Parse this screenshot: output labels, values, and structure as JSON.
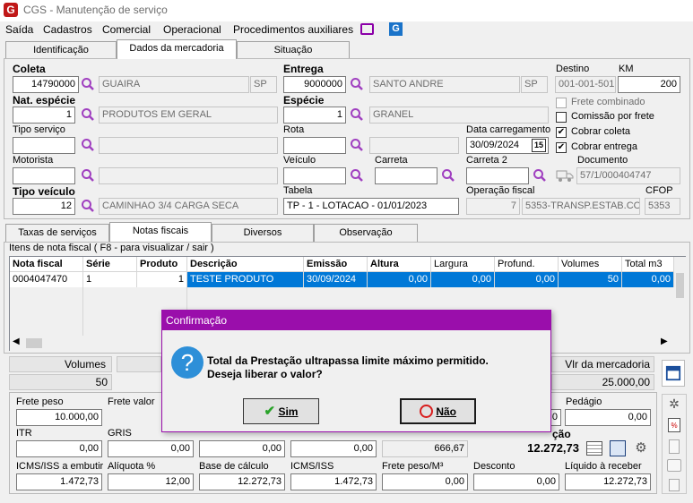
{
  "window": {
    "title": "CGS - Manutenção de serviço"
  },
  "menu": [
    "Saída",
    "Cadastros",
    "Comercial",
    "Operacional",
    "Procedimentos auxiliares"
  ],
  "top_tabs": [
    "Identificação",
    "Dados da mercadoria",
    "Situação"
  ],
  "header": {
    "coleta_label": "Coleta",
    "coleta_value": "14790000",
    "coleta_city": "GUAIRA",
    "coleta_uf": "SP",
    "entrega_label": "Entrega",
    "entrega_value": "9000000",
    "entrega_city": "SANTO ANDRE",
    "entrega_uf": "SP",
    "destino_label": "Destino",
    "destino_value": "001-001-501",
    "km_label": "KM",
    "km_value": "200",
    "nat_label": "Nat. espécie",
    "nat_value": "1",
    "nat_desc": "PRODUTOS EM GERAL",
    "especie_label": "Espécie",
    "especie_value": "1",
    "especie_desc": "GRANEL",
    "frete_combinado": "Frete combinado",
    "comissao": "Comissão por frete",
    "cobrar_coleta": "Cobrar coleta",
    "cobrar_entrega": "Cobrar entrega",
    "tipo_servico_label": "Tipo serviço",
    "rota_label": "Rota",
    "data_carreg_label": "Data carregamento",
    "data_carreg_value": "30/09/2024",
    "cal_badge": "15",
    "motorista_label": "Motorista",
    "veiculo_label": "Veículo",
    "carreta_label": "Carreta",
    "carreta2_label": "Carreta 2",
    "documento_label": "Documento",
    "documento_value": "57/1/000404747",
    "tipo_veiculo_label": "Tipo veículo",
    "tipo_veiculo_value": "12",
    "tipo_veiculo_desc": "CAMINHAO 3/4 CARGA SECA",
    "tabela_label": "Tabela",
    "tabela_value": "TP - 1 - LOTACAO - 01/01/2023",
    "op_fiscal_label": "Operação fiscal",
    "op_fiscal_code": "7",
    "op_fiscal_desc": "5353-TRANSP.ESTAB.CO",
    "cfop_label": "CFOP",
    "cfop_value": "5353"
  },
  "sub_tabs": [
    "Taxas de serviços",
    "Notas fiscais",
    "Diversos",
    "Observação"
  ],
  "items": {
    "title": "Itens de nota fiscal ( F8 - para visualizar / sair )",
    "columns": [
      "Nota fiscal",
      "Série",
      "Produto",
      "Descrição",
      "Emissão",
      "Altura",
      "Largura",
      "Profund.",
      "Volumes",
      "Total m3"
    ],
    "rows": [
      [
        "0004047470",
        "1",
        "1",
        "TESTE PRODUTO",
        "30/09/2024",
        "0,00",
        "0,00",
        "0,00",
        "50",
        "0,00"
      ]
    ]
  },
  "totals": {
    "volumes_label": "Volumes",
    "volumes_value": "50",
    "vlr_merc_label": "Vlr da mercadoria",
    "vlr_merc_value": "25.000,00"
  },
  "bottom": {
    "frete_peso_label": "Frete peso",
    "frete_peso_value": "10.000,00",
    "frete_valor_label": "Frete valor",
    "pedagio_label": "Pedágio",
    "pedagio_value": "0,00",
    "partial_0": "0",
    "itr_label": "ITR",
    "itr_value": "0,00",
    "gris_label": "GRIS",
    "gris_value": "0,00",
    "c3_value": "0,00",
    "c4_value": "0,00",
    "c5_value": "666,67",
    "prestacao_partial": "ção",
    "total_value": "12.272,73",
    "icms_embutir_label": "ICMS/ISS a embutir",
    "icms_embutir_value": "1.472,73",
    "aliquota_label": "Alíquota %",
    "aliquota_value": "12,00",
    "base_label": "Base de cálculo",
    "base_value": "12.272,73",
    "icms_label": "ICMS/ISS",
    "icms_value": "1.472,73",
    "frete_m3_label": "Frete peso/M³",
    "frete_m3_value": "0,00",
    "desconto_label": "Desconto",
    "desconto_value": "0,00",
    "liquido_label": "Líquido à receber",
    "liquido_value": "12.272,73"
  },
  "dialog": {
    "title": "Confirmação",
    "message": "Total da Prestação ultrapassa limite máximo permitido. Deseja liberar o valor?",
    "yes": "Sim",
    "no": "Não"
  },
  "colors": {
    "dialog_purple": "#9a0eab",
    "selection": "#0078d7",
    "mag_icon": "#a040c0"
  }
}
